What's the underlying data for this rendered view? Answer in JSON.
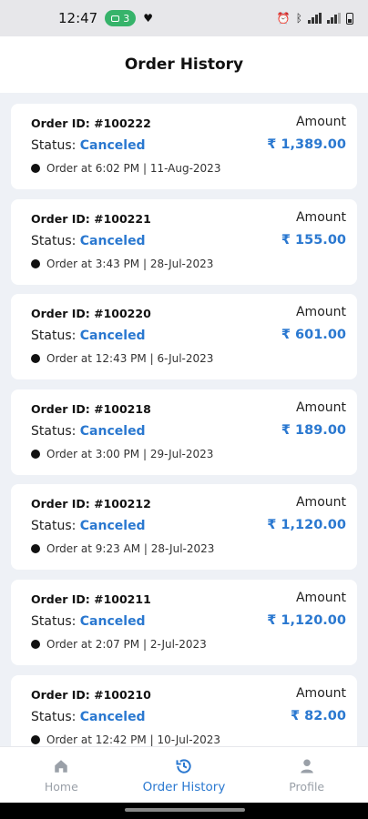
{
  "status_bar": {
    "time": "12:47",
    "badge_count": "3"
  },
  "header": {
    "title": "Order History"
  },
  "orders": [
    {
      "id": "Order ID: #100222",
      "status_label": "Status:",
      "status": "Canceled",
      "time": "Order at 6:02 PM | 11-Aug-2023",
      "amount_label": "Amount",
      "amount": "₹ 1,389.00"
    },
    {
      "id": "Order ID: #100221",
      "status_label": "Status:",
      "status": "Canceled",
      "time": "Order at 3:43 PM | 28-Jul-2023",
      "amount_label": "Amount",
      "amount": "₹ 155.00"
    },
    {
      "id": "Order ID: #100220",
      "status_label": "Status:",
      "status": "Canceled",
      "time": "Order at 12:43 PM | 6-Jul-2023",
      "amount_label": "Amount",
      "amount": "₹ 601.00"
    },
    {
      "id": "Order ID: #100218",
      "status_label": "Status:",
      "status": "Canceled",
      "time": "Order at 3:00 PM | 29-Jul-2023",
      "amount_label": "Amount",
      "amount": "₹ 189.00"
    },
    {
      "id": "Order ID: #100212",
      "status_label": "Status:",
      "status": "Canceled",
      "time": "Order at 9:23 AM | 28-Jul-2023",
      "amount_label": "Amount",
      "amount": "₹ 1,120.00"
    },
    {
      "id": "Order ID: #100211",
      "status_label": "Status:",
      "status": "Canceled",
      "time": "Order at 2:07 PM | 2-Jul-2023",
      "amount_label": "Amount",
      "amount": "₹ 1,120.00"
    },
    {
      "id": "Order ID: #100210",
      "status_label": "Status:",
      "status": "Canceled",
      "time": "Order at 12:42 PM | 10-Jul-2023",
      "amount_label": "Amount",
      "amount": "₹ 82.00"
    }
  ],
  "bottom_nav": {
    "items": [
      {
        "label": "Home",
        "icon": "home-icon"
      },
      {
        "label": "Order History",
        "icon": "history-icon"
      },
      {
        "label": "Profile",
        "icon": "profile-icon"
      }
    ]
  },
  "colors": {
    "accent": "#2a78d0",
    "background": "#eef1f6"
  }
}
